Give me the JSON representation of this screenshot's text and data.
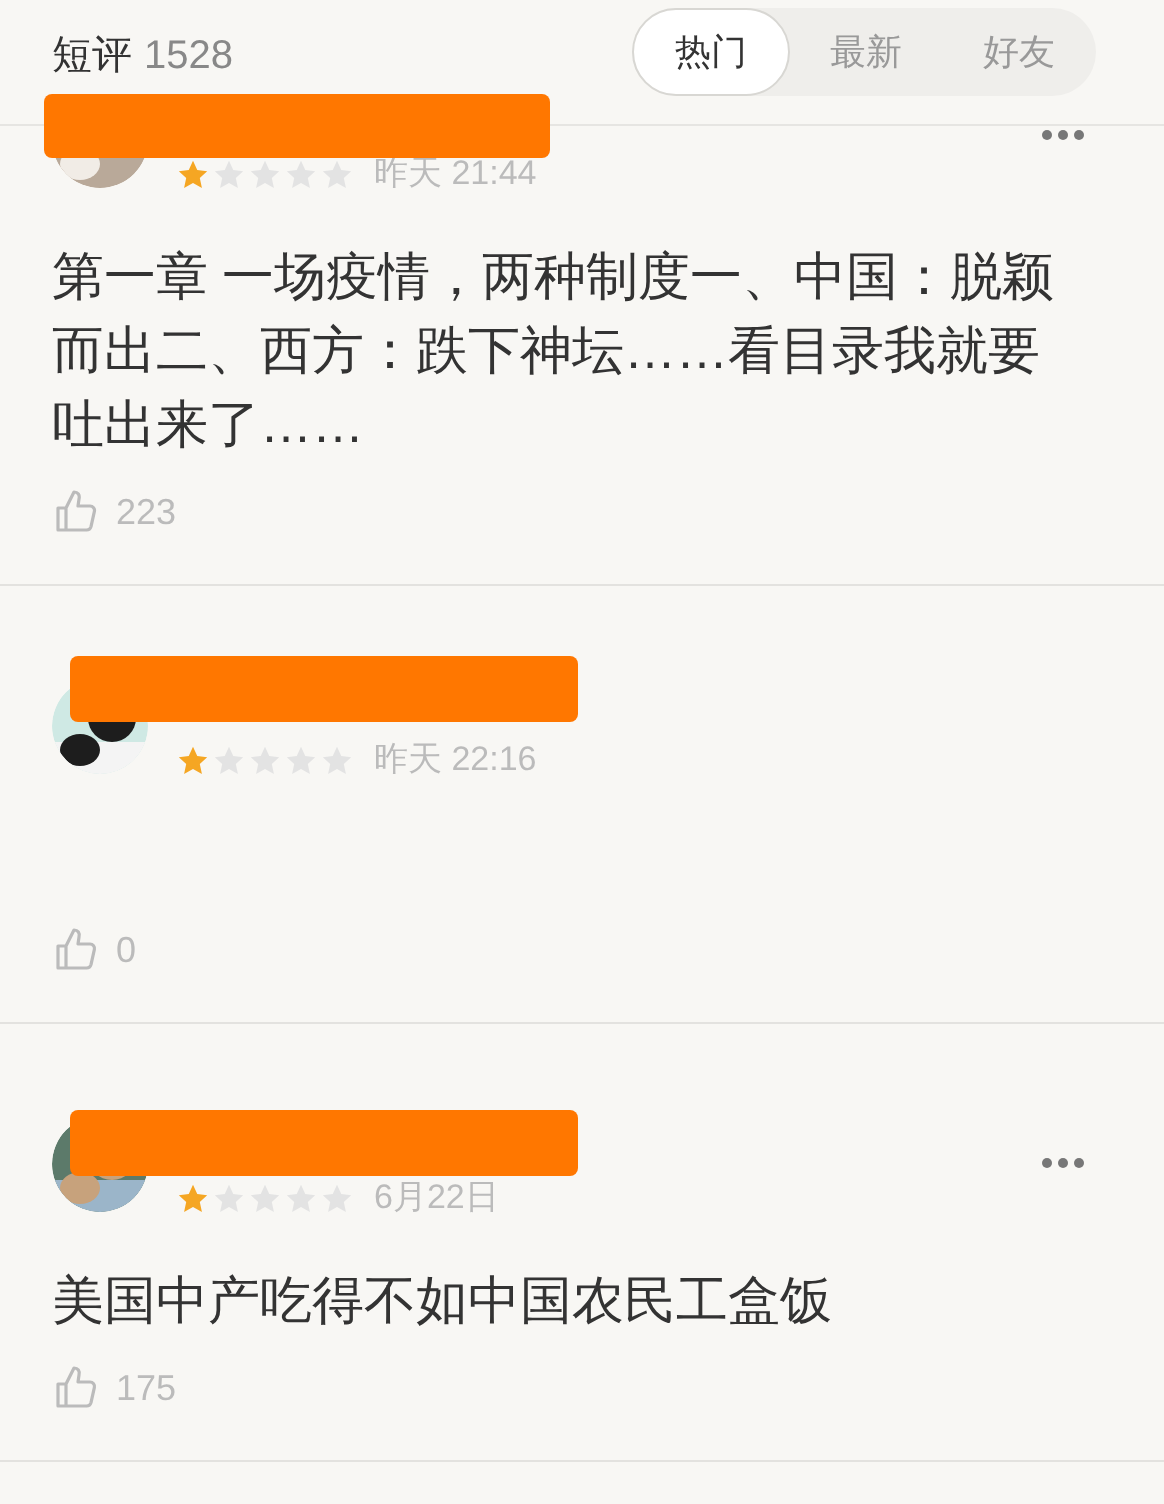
{
  "header": {
    "title": "短评",
    "count": "1528"
  },
  "tabs": [
    {
      "label": "热门",
      "selected": true
    },
    {
      "label": "最新",
      "selected": false
    },
    {
      "label": "好友",
      "selected": false
    }
  ],
  "reviews": [
    {
      "stars": 1,
      "time": "昨天 21:44",
      "text": "第一章 一场疫情，两种制度一、中国：脱颖而出二、西方：跌下神坛……看目录我就要吐出来了……",
      "likes": "223",
      "has_menu": true
    },
    {
      "stars": 1,
      "time": "昨天 22:16",
      "likes": "0",
      "has_menu": false
    },
    {
      "stars": 1,
      "time": "6月22日",
      "text": "美国中产吃得不如中国农民工盒饭",
      "likes": "175",
      "has_menu": true
    }
  ]
}
